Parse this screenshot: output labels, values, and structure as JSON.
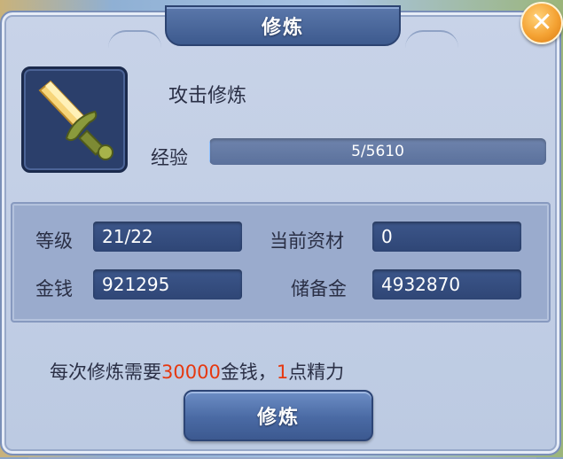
{
  "window": {
    "title": "修炼",
    "close_icon": "close-icon"
  },
  "skill": {
    "name": "攻击修炼",
    "icon": "sword-icon",
    "exp_label": "经验",
    "exp_value": "5/5610",
    "exp_progress": 0.0009
  },
  "stats": {
    "level_label": "等级",
    "level_value": "21/22",
    "material_label": "当前资材",
    "material_value": "0",
    "money_label": "金钱",
    "money_value": "921295",
    "reserve_label": "储备金",
    "reserve_value": "4932870"
  },
  "info": {
    "prefix": "每次修炼需要",
    "cost_amount": "30000",
    "mid": "金钱，",
    "energy_amount": "1",
    "suffix": "点精力"
  },
  "actions": {
    "train_label": "修炼"
  },
  "colors": {
    "highlight": "#e6380f",
    "accent": "#3d5a8e",
    "close": "#f4a233"
  }
}
